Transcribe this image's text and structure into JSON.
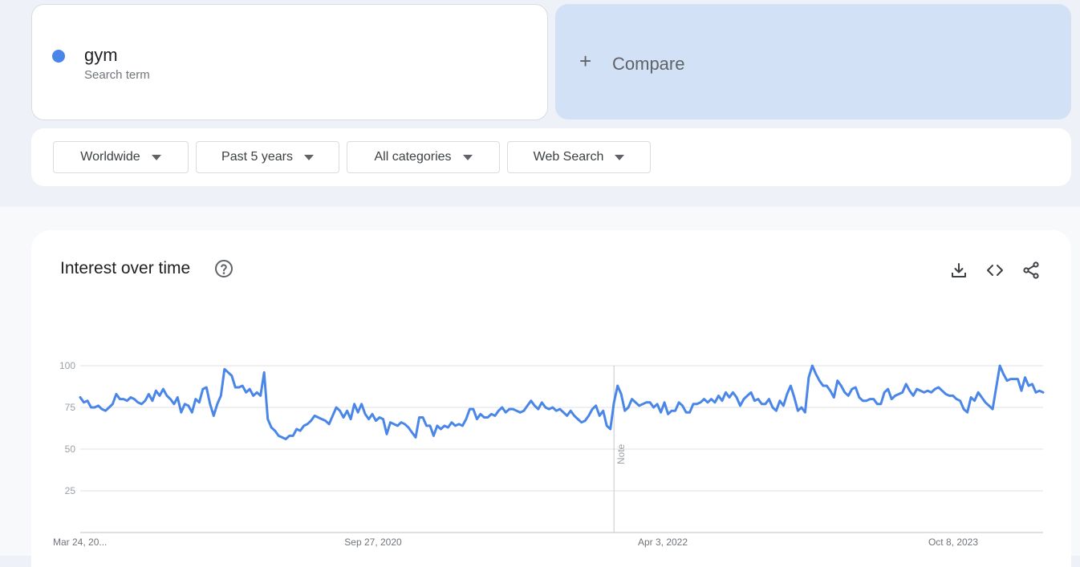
{
  "term": {
    "name": "gym",
    "subtitle": "Search term",
    "color": "#4a86e8"
  },
  "compare": {
    "plus": "+",
    "label": "Compare"
  },
  "filters": [
    {
      "label": "Worldwide"
    },
    {
      "label": "Past 5 years"
    },
    {
      "label": "All categories"
    },
    {
      "label": "Web Search"
    }
  ],
  "chart": {
    "title": "Interest over time",
    "icons": [
      "help-icon",
      "download-icon",
      "embed-code-icon",
      "share-icon"
    ]
  },
  "chart_data": {
    "type": "line",
    "title": "Interest over time",
    "series_color": "#4a86e8",
    "ylim": [
      0,
      100
    ],
    "yticks": [
      25,
      50,
      75,
      100
    ],
    "grid": true,
    "x_labels": [
      "Mar 24, 20...",
      "Sep 27, 2020",
      "Apr 3, 2022",
      "Oct 8, 2023"
    ],
    "note_label": "Note",
    "series": [
      {
        "values": [
          81,
          78,
          79,
          75,
          75,
          76,
          74,
          73,
          75,
          77,
          83,
          80,
          80,
          79,
          81,
          80,
          78,
          77,
          79,
          83,
          79,
          85,
          82,
          86,
          82,
          80,
          77,
          81,
          72,
          77,
          76,
          72,
          80,
          78,
          86,
          87,
          77,
          70,
          77,
          82,
          98,
          96,
          94,
          87,
          87,
          88,
          84,
          86,
          82,
          84,
          82,
          96,
          68,
          63,
          61,
          58,
          57,
          56,
          58,
          58,
          62,
          61,
          64,
          65,
          67,
          70,
          69,
          68,
          67,
          65,
          70,
          75,
          73,
          69,
          73,
          68,
          77,
          72,
          77,
          71,
          68,
          71,
          67,
          69,
          68,
          59,
          66,
          65,
          64,
          66,
          65,
          63,
          60,
          57,
          69,
          69,
          64,
          64,
          58,
          64,
          62,
          64,
          63,
          66,
          64,
          65,
          64,
          68,
          74,
          74,
          68,
          71,
          69,
          69,
          71,
          70,
          73,
          75,
          72,
          74,
          74,
          73,
          72,
          73,
          76,
          79,
          76,
          74,
          78,
          75,
          74,
          75,
          73,
          74,
          72,
          70,
          73,
          70,
          68,
          66,
          67,
          70,
          74,
          76,
          70,
          73,
          64,
          62,
          78,
          88,
          83,
          73,
          75,
          80,
          78,
          76,
          77,
          78,
          78,
          75,
          77,
          72,
          78,
          71,
          73,
          73,
          78,
          76,
          72,
          72,
          77,
          77,
          78,
          80,
          78,
          80,
          78,
          82,
          79,
          84,
          81,
          84,
          81,
          76,
          80,
          82,
          84,
          79,
          80,
          77,
          77,
          80,
          75,
          73,
          79,
          76,
          83,
          88,
          81,
          73,
          75,
          72,
          93,
          100,
          95,
          91,
          88,
          88,
          85,
          81,
          91,
          88,
          84,
          82,
          86,
          87,
          81,
          79,
          79,
          80,
          80,
          77,
          77,
          84,
          86,
          80,
          82,
          83,
          84,
          89,
          85,
          82,
          86,
          85,
          84,
          85,
          84,
          86,
          87,
          85,
          83,
          82,
          82,
          80,
          79,
          74,
          72,
          81,
          79,
          84,
          81,
          78,
          76,
          74,
          87,
          100,
          95,
          91,
          92,
          92,
          92,
          85,
          93,
          88,
          89,
          84,
          85,
          84
        ]
      }
    ]
  }
}
